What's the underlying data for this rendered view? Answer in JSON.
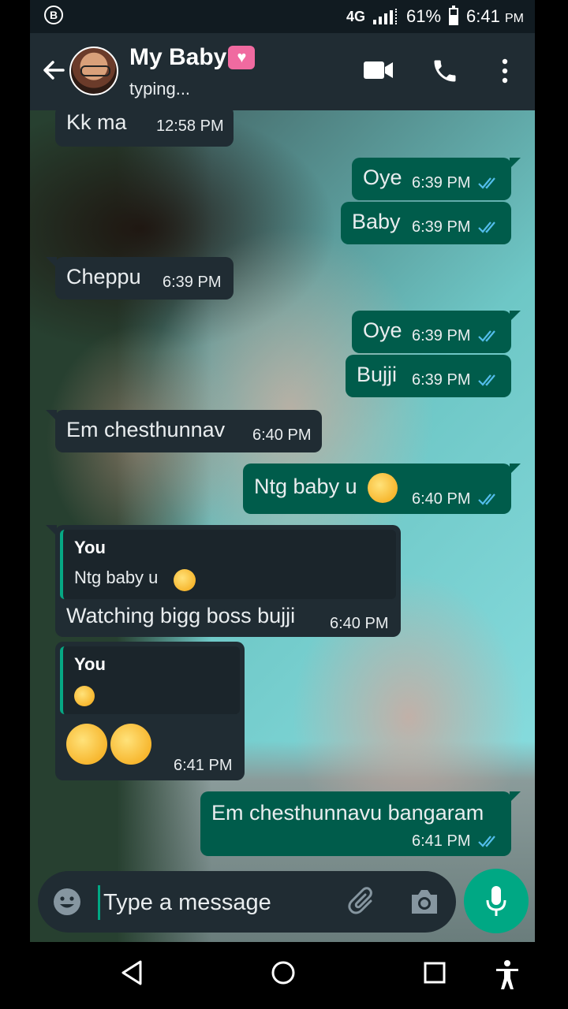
{
  "status_bar": {
    "notification_icon": "B",
    "network": "4G",
    "battery": "61%",
    "time": "6:41",
    "ampm": "PM"
  },
  "header": {
    "contact_name": "My Baby",
    "status": "typing..."
  },
  "messages": [
    {
      "direction": "in",
      "text": "Kk ma",
      "time": "12:58 PM"
    },
    {
      "direction": "out",
      "text": "Oye",
      "time": "6:39 PM"
    },
    {
      "direction": "out",
      "text": "Baby",
      "time": "6:39 PM"
    },
    {
      "direction": "in",
      "text": "Cheppu",
      "time": "6:39 PM"
    },
    {
      "direction": "out",
      "text": "Oye",
      "time": "6:39 PM"
    },
    {
      "direction": "out",
      "text": "Bujji",
      "time": "6:39 PM"
    },
    {
      "direction": "in",
      "text": "Em chesthunnav",
      "time": "6:40 PM"
    },
    {
      "direction": "out",
      "text": "Ntg baby u",
      "time": "6:40 PM"
    },
    {
      "direction": "in",
      "quote_author": "You",
      "quote_text": "Ntg baby u",
      "text": "Watching bigg boss bujji",
      "time": "6:40 PM"
    },
    {
      "direction": "in",
      "quote_author": "You",
      "text": "",
      "time": "6:41 PM"
    },
    {
      "direction": "out",
      "text": "Em chesthunnavu bangaram",
      "time": "6:41 PM"
    }
  ],
  "input": {
    "placeholder": "Type a message"
  },
  "colors": {
    "outgoing_bubble": "#005c4b",
    "incoming_bubble": "#202c33",
    "accent": "#00a884",
    "read_ticks": "#53bdeb"
  }
}
